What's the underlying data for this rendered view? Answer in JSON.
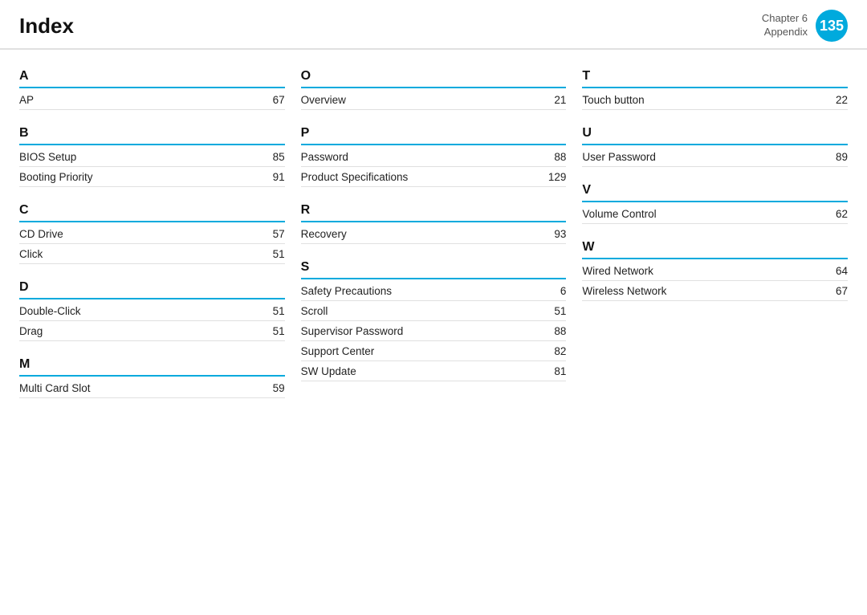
{
  "header": {
    "title": "Index",
    "chapter_label": "Chapter 6",
    "appendix_label": "Appendix",
    "page_number": "135"
  },
  "columns": [
    {
      "sections": [
        {
          "letter": "A",
          "entries": [
            {
              "label": "AP",
              "page": "67"
            }
          ]
        },
        {
          "letter": "B",
          "entries": [
            {
              "label": "BIOS Setup",
              "page": "85"
            },
            {
              "label": "Booting Priority",
              "page": "91"
            }
          ]
        },
        {
          "letter": "C",
          "entries": [
            {
              "label": "CD Drive",
              "page": "57"
            },
            {
              "label": "Click",
              "page": "51"
            }
          ]
        },
        {
          "letter": "D",
          "entries": [
            {
              "label": "Double-Click",
              "page": "51"
            },
            {
              "label": "Drag",
              "page": "51"
            }
          ]
        },
        {
          "letter": "M",
          "entries": [
            {
              "label": "Multi Card Slot",
              "page": "59"
            }
          ]
        }
      ]
    },
    {
      "sections": [
        {
          "letter": "O",
          "entries": [
            {
              "label": "Overview",
              "page": "21"
            }
          ]
        },
        {
          "letter": "P",
          "entries": [
            {
              "label": "Password",
              "page": "88"
            },
            {
              "label": "Product Specifications",
              "page": "129"
            }
          ]
        },
        {
          "letter": "R",
          "entries": [
            {
              "label": "Recovery",
              "page": "93"
            }
          ]
        },
        {
          "letter": "S",
          "entries": [
            {
              "label": "Safety Precautions",
              "page": "6"
            },
            {
              "label": "Scroll",
              "page": "51"
            },
            {
              "label": "Supervisor Password",
              "page": "88"
            },
            {
              "label": "Support Center",
              "page": "82"
            },
            {
              "label": "SW Update",
              "page": "81"
            }
          ]
        }
      ]
    },
    {
      "sections": [
        {
          "letter": "T",
          "entries": [
            {
              "label": "Touch button",
              "page": "22"
            }
          ]
        },
        {
          "letter": "U",
          "entries": [
            {
              "label": "User Password",
              "page": "89"
            }
          ]
        },
        {
          "letter": "V",
          "entries": [
            {
              "label": "Volume Control",
              "page": "62"
            }
          ]
        },
        {
          "letter": "W",
          "entries": [
            {
              "label": "Wired Network",
              "page": "64"
            },
            {
              "label": "Wireless Network",
              "page": "67"
            }
          ]
        }
      ]
    }
  ]
}
